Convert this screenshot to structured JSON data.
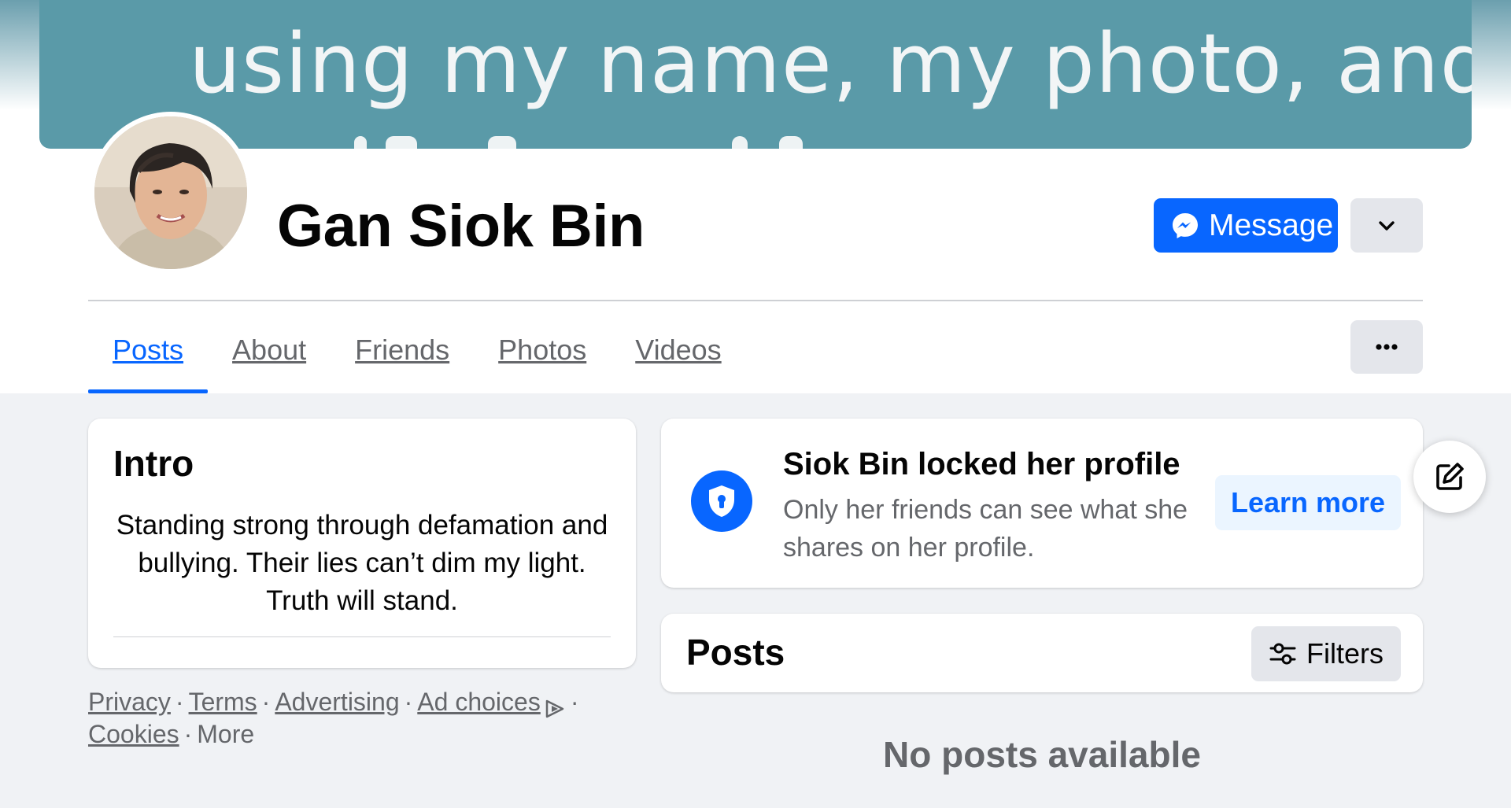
{
  "cover": {
    "visible_text": "using my name, my photo, and"
  },
  "profile": {
    "name": "Gan Siok Bin"
  },
  "actions": {
    "message_label": "Message"
  },
  "tabs": [
    {
      "label": "Posts",
      "active": true
    },
    {
      "label": "About",
      "active": false
    },
    {
      "label": "Friends",
      "active": false
    },
    {
      "label": "Photos",
      "active": false
    },
    {
      "label": "Videos",
      "active": false
    }
  ],
  "intro": {
    "title": "Intro",
    "bio": "Standing strong through defamation and bullying. Their lies can’t dim my light. Truth will stand."
  },
  "footer": {
    "privacy": "Privacy",
    "terms": "Terms",
    "advertising": "Advertising",
    "ad_choices": "Ad choices",
    "cookies": "Cookies",
    "more": "More",
    "separator": "·"
  },
  "locked": {
    "title": "Siok Bin locked her profile",
    "description": "Only her friends can see what she shares on her profile.",
    "learn_more": "Learn more"
  },
  "posts": {
    "title": "Posts",
    "filters_label": "Filters",
    "empty_text": "No posts available"
  },
  "colors": {
    "brand_blue": "#0866ff",
    "cover_teal": "#5a9aa8",
    "secondary_text": "#65676b",
    "button_gray": "#e4e6eb",
    "page_bg": "#f0f2f5"
  }
}
